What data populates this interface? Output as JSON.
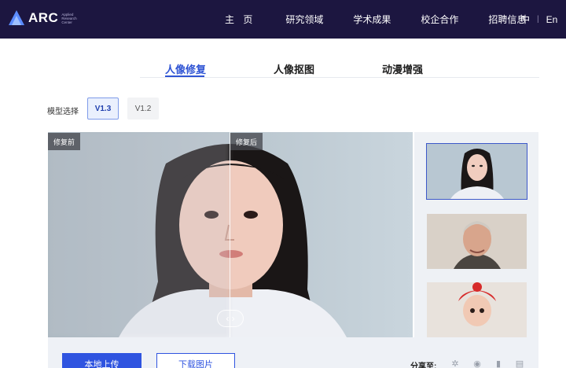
{
  "header": {
    "logo_text": "ARC",
    "logo_sub": "Applied Research Center",
    "nav": [
      {
        "label": "主 页"
      },
      {
        "label": "研究领域"
      },
      {
        "label": "学术成果"
      },
      {
        "label": "校企合作"
      },
      {
        "label": "招聘信息"
      }
    ],
    "lang_zh": "中",
    "lang_sep": "|",
    "lang_en": "En"
  },
  "tabs": [
    {
      "label": "人像修复",
      "active": true
    },
    {
      "label": "人像抠图",
      "active": false
    },
    {
      "label": "动漫增强",
      "active": false
    }
  ],
  "model_select": {
    "label": "模型选择",
    "options": [
      {
        "label": "V1.3",
        "selected": true
      },
      {
        "label": "V1.2",
        "selected": false
      }
    ]
  },
  "preview": {
    "before_label": "修复前",
    "after_label": "修复后",
    "handle_glyph": "‹ ›"
  },
  "actions": {
    "upload_label": "本地上传",
    "download_label": "下载图片"
  },
  "share": {
    "label": "分享至:",
    "icons": [
      "settings-icon",
      "weibo-icon",
      "microphone-icon",
      "bookmark-icon"
    ]
  },
  "colors": {
    "header_bg": "#1c1640",
    "accent": "#2f54d4"
  }
}
